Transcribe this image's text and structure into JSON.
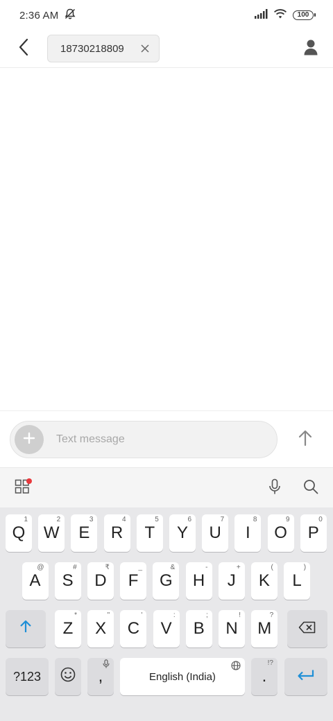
{
  "status_bar": {
    "time": "2:36 AM",
    "battery": "100",
    "icons": [
      "alarm-off-icon",
      "signal-icon",
      "wifi-icon",
      "battery-icon"
    ]
  },
  "header": {
    "recipient": "18730218809"
  },
  "composer": {
    "placeholder": "Text message"
  },
  "keyboard": {
    "row1": [
      {
        "key": "Q",
        "hint": "1"
      },
      {
        "key": "W",
        "hint": "2"
      },
      {
        "key": "E",
        "hint": "3"
      },
      {
        "key": "R",
        "hint": "4"
      },
      {
        "key": "T",
        "hint": "5"
      },
      {
        "key": "Y",
        "hint": "6"
      },
      {
        "key": "U",
        "hint": "7"
      },
      {
        "key": "I",
        "hint": "8"
      },
      {
        "key": "O",
        "hint": "9"
      },
      {
        "key": "P",
        "hint": "0"
      }
    ],
    "row2": [
      {
        "key": "A",
        "hint": "@"
      },
      {
        "key": "S",
        "hint": "#"
      },
      {
        "key": "D",
        "hint": "₹"
      },
      {
        "key": "F",
        "hint": "_"
      },
      {
        "key": "G",
        "hint": "&"
      },
      {
        "key": "H",
        "hint": "-"
      },
      {
        "key": "J",
        "hint": "+"
      },
      {
        "key": "K",
        "hint": "("
      },
      {
        "key": "L",
        "hint": ")"
      }
    ],
    "row3": [
      {
        "key": "Z",
        "hint": "*"
      },
      {
        "key": "X",
        "hint": "\""
      },
      {
        "key": "C",
        "hint": "'"
      },
      {
        "key": "V",
        "hint": ":"
      },
      {
        "key": "B",
        "hint": ";"
      },
      {
        "key": "N",
        "hint": "!"
      },
      {
        "key": "M",
        "hint": "?"
      }
    ],
    "symbols_label": "?123",
    "comma": ",",
    "space_label": "English (India)",
    "period": ".",
    "period_hint": "!?"
  },
  "colors": {
    "accent": "#1f8fd6",
    "notification_dot": "#e8383c"
  }
}
